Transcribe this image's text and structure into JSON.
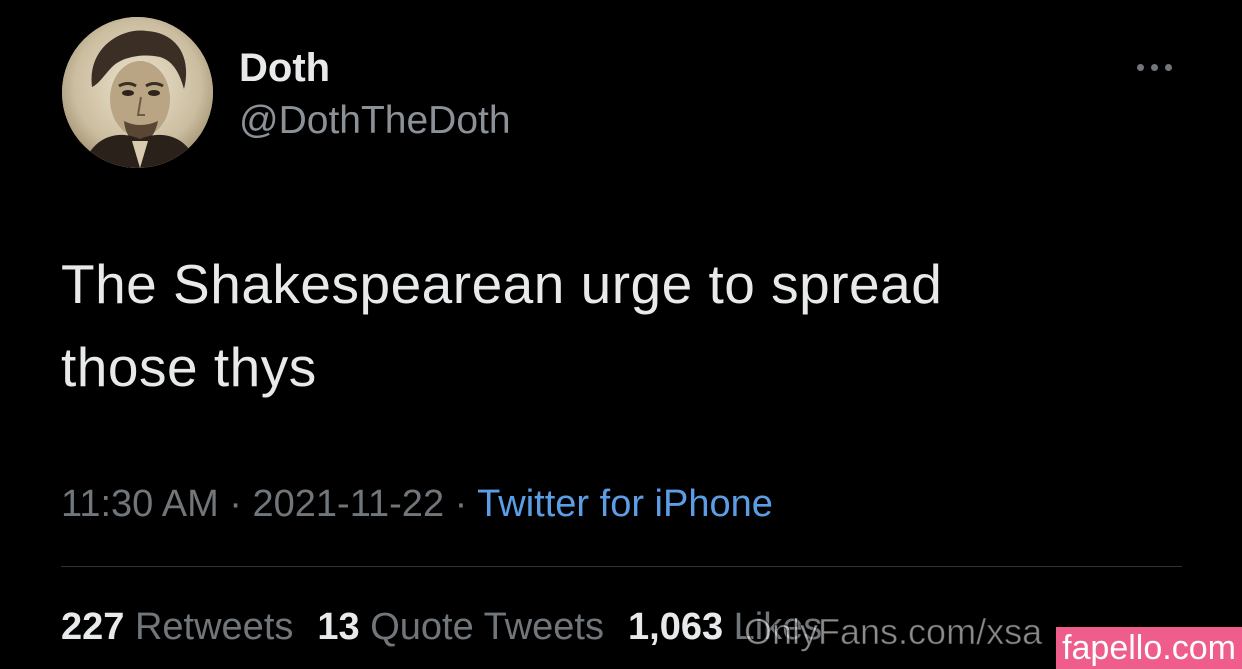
{
  "tweet": {
    "author": {
      "display_name": "Doth",
      "handle": "@DothTheDoth"
    },
    "text_line1": "The Shakespearean urge to spread",
    "text_line2": "those thys",
    "time": "11:30 AM",
    "separator": "·",
    "date": "2021-11-22",
    "source": "Twitter for iPhone",
    "stats": {
      "retweets_count": "227",
      "retweets_label": "Retweets",
      "quotes_count": "13",
      "quotes_label": "Quote Tweets",
      "likes_count": "1,063",
      "likes_label": "Likes"
    },
    "more_icon": "more-horizontal-icon"
  },
  "watermarks": {
    "text": "OnlyFans.com/xsa",
    "badge": "fapello.com"
  },
  "colors": {
    "background": "#000000",
    "primary_text": "#e7e9ea",
    "secondary_text": "#71767b",
    "link": "#5b9ee6",
    "badge": "#ee5d8c"
  }
}
